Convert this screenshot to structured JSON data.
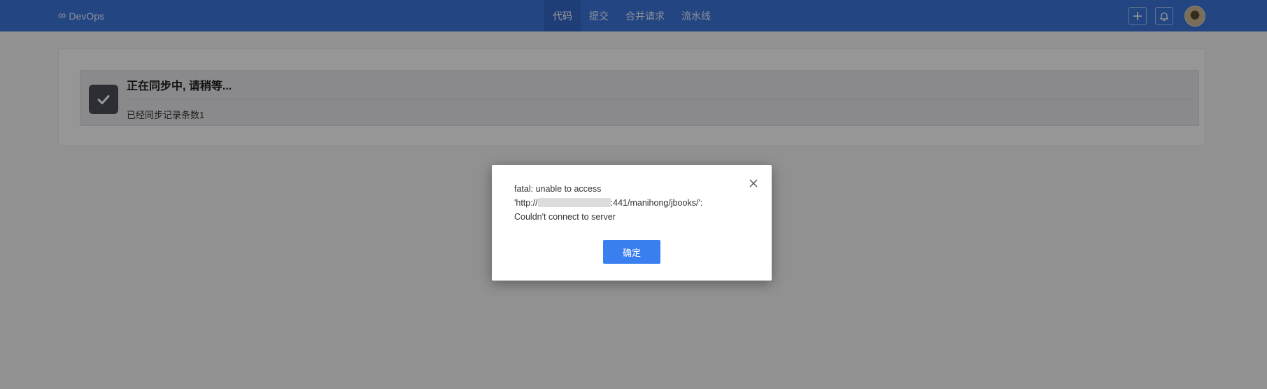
{
  "app": {
    "brand_icon": "∞",
    "brand_name": "DevOps"
  },
  "nav": {
    "items": [
      {
        "label": "代码",
        "active": true
      },
      {
        "label": "提交",
        "active": false
      },
      {
        "label": "合并请求",
        "active": false
      },
      {
        "label": "流水线",
        "active": false
      }
    ]
  },
  "toolbar": {
    "add_icon": "plus-icon",
    "bell_icon": "bell-icon"
  },
  "sync": {
    "title": "正在同步中, 请稍等...",
    "count_text": "已经同步记录条数1"
  },
  "dialog": {
    "line1": "fatal: unable to access",
    "url_prefix": "'http://",
    "url_suffix": ":441/manihong/jbooks/':",
    "line3": "Couldn't connect to server",
    "ok_label": "确定"
  },
  "colors": {
    "topbar": "#3b73d9",
    "primary_button": "#3a7ff0",
    "overlay": "rgba(0,0,0,0.4)"
  }
}
